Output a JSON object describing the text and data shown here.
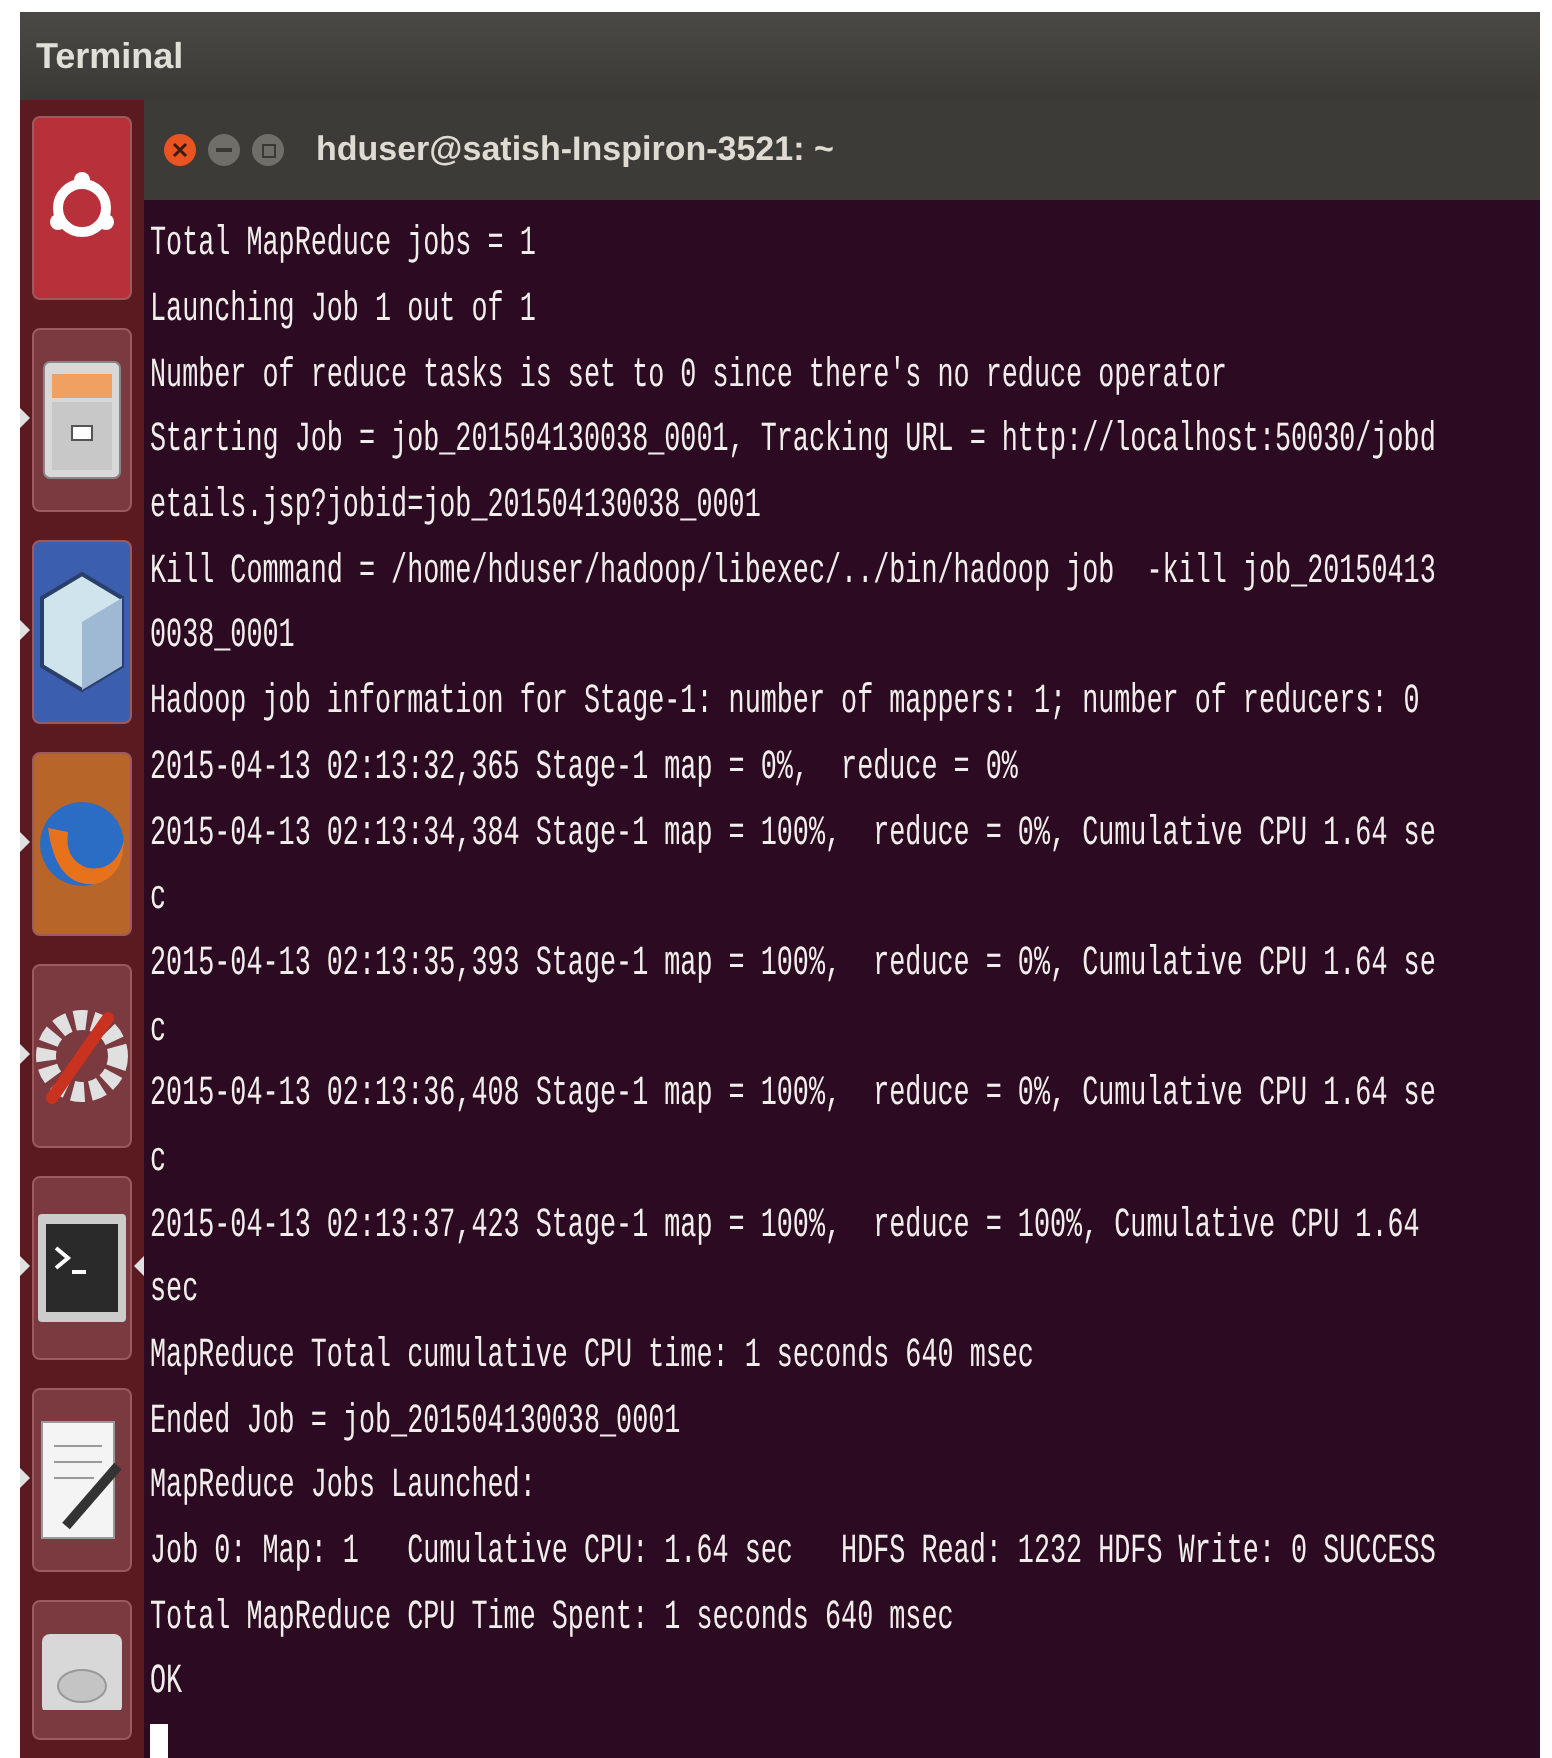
{
  "top_bar": {
    "title": "Terminal"
  },
  "launcher": {
    "items": [
      {
        "kind": "ubuntu",
        "running": false,
        "active": false
      },
      {
        "kind": "files",
        "running": true,
        "active": false
      },
      {
        "kind": "cube",
        "running": true,
        "active": false
      },
      {
        "kind": "browser",
        "running": true,
        "active": false
      },
      {
        "kind": "settings",
        "running": true,
        "active": false
      },
      {
        "kind": "terminal",
        "running": true,
        "active": true
      },
      {
        "kind": "editor",
        "running": true,
        "active": false
      },
      {
        "kind": "disk",
        "running": false,
        "active": false
      }
    ]
  },
  "window": {
    "title": "hduser@satish-Inspiron-3521: ~"
  },
  "terminal": {
    "lines": [
      "Total MapReduce jobs = 1",
      "Launching Job 1 out of 1",
      "Number of reduce tasks is set to 0 since there's no reduce operator",
      "Starting Job = job_201504130038_0001, Tracking URL = http://localhost:50030/jobd",
      "etails.jsp?jobid=job_201504130038_0001",
      "Kill Command = /home/hduser/hadoop/libexec/../bin/hadoop job  -kill job_20150413",
      "0038_0001",
      "Hadoop job information for Stage-1: number of mappers: 1; number of reducers: 0",
      "2015-04-13 02:13:32,365 Stage-1 map = 0%,  reduce = 0%",
      "2015-04-13 02:13:34,384 Stage-1 map = 100%,  reduce = 0%, Cumulative CPU 1.64 se",
      "c",
      "2015-04-13 02:13:35,393 Stage-1 map = 100%,  reduce = 0%, Cumulative CPU 1.64 se",
      "c",
      "2015-04-13 02:13:36,408 Stage-1 map = 100%,  reduce = 0%, Cumulative CPU 1.64 se",
      "c",
      "2015-04-13 02:13:37,423 Stage-1 map = 100%,  reduce = 100%, Cumulative CPU 1.64",
      "sec",
      "MapReduce Total cumulative CPU time: 1 seconds 640 msec",
      "Ended Job = job_201504130038_0001",
      "MapReduce Jobs Launched:",
      "Job 0: Map: 1   Cumulative CPU: 1.64 sec   HDFS Read: 1232 HDFS Write: 0 SUCCESS",
      "Total MapReduce CPU Time Spent: 1 seconds 640 msec",
      "OK"
    ],
    "cursor": true
  }
}
